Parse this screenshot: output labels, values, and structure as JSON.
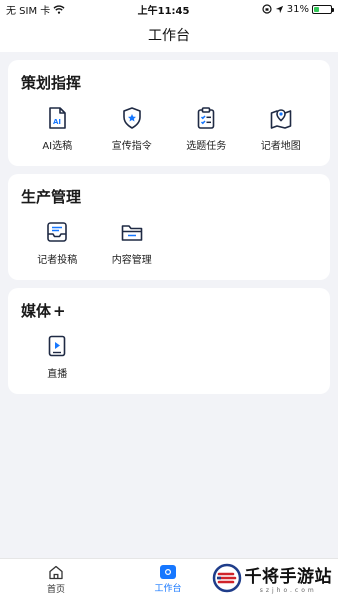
{
  "status_bar": {
    "carrier": "无 SIM 卡",
    "time": "上午11:45",
    "battery": "31%",
    "battery_level": 0.31
  },
  "header": {
    "title": "工作台"
  },
  "sections": [
    {
      "title": "策划指挥",
      "items": [
        {
          "label": "AI选稿",
          "icon": "ai-document-icon"
        },
        {
          "label": "宣传指令",
          "icon": "shield-star-icon"
        },
        {
          "label": "选题任务",
          "icon": "clipboard-checklist-icon"
        },
        {
          "label": "记者地图",
          "icon": "map-pin-icon"
        }
      ]
    },
    {
      "title": "生产管理",
      "items": [
        {
          "label": "记者投稿",
          "icon": "inbox-document-icon"
        },
        {
          "label": "内容管理",
          "icon": "folder-icon"
        }
      ]
    },
    {
      "title": "媒体",
      "title_suffix": "+",
      "items": [
        {
          "label": "直播",
          "icon": "live-play-icon"
        }
      ]
    }
  ],
  "tabbar": {
    "items": [
      {
        "label": "首页",
        "icon": "home-icon",
        "active": false
      },
      {
        "label": "工作台",
        "icon": "workbench-icon",
        "active": true
      }
    ]
  },
  "watermark": {
    "text": "千将手游站",
    "domain": "szjho.com"
  },
  "colors": {
    "accent": "#1677ff",
    "background": "#f2f3f7",
    "icon": "#1f2a44"
  }
}
